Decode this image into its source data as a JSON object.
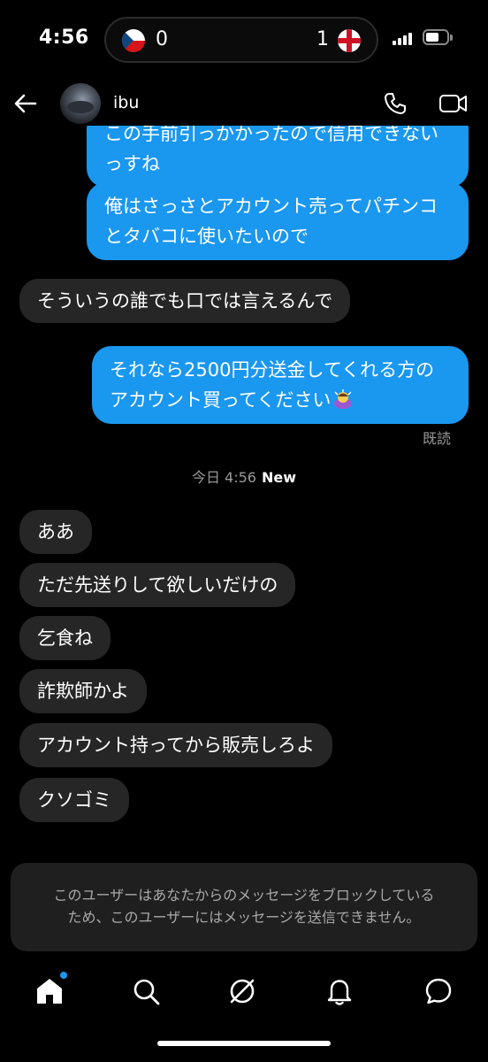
{
  "status_bar": {
    "time": "4:56",
    "score_left": "0",
    "score_right": "1"
  },
  "header": {
    "username": "ibu"
  },
  "messages": [
    {
      "dir": "out",
      "text": "この手前引っかかったので信用できない"
    },
    {
      "dir": "out",
      "text": "っすね"
    },
    {
      "dir": "out",
      "text": "俺はさっさとアカウント売ってパチンコ"
    },
    {
      "dir": "out",
      "text": "とタバコに使いたいので"
    },
    {
      "dir": "in",
      "text": "そういうの誰でも口では言えるんで"
    },
    {
      "dir": "out",
      "text": "それなら2500円分送金してくれる方の"
    },
    {
      "dir": "out",
      "text": "アカウント買ってください"
    },
    {
      "dir": "in",
      "text": "ああ"
    },
    {
      "dir": "in",
      "text": "ただ先送りして欲しいだけの"
    },
    {
      "dir": "in",
      "text": "乞食ね"
    },
    {
      "dir": "in",
      "text": "詐欺師かよ"
    },
    {
      "dir": "in",
      "text": "アカウント持ってから販売しろよ"
    },
    {
      "dir": "in",
      "text": "クソゴミ"
    }
  ],
  "read_receipt": "既読",
  "divider": {
    "time": "今日 4:56",
    "new_label": "New"
  },
  "block_notice": {
    "line1": "このユーザーはあなたからのメッセージをブロックしている",
    "line2": "ため、このユーザーにはメッセージを送信できません。"
  },
  "nav": [
    "home-icon",
    "search-icon",
    "explore-icon",
    "notifications-icon",
    "messages-icon"
  ],
  "colors": {
    "outgoing_bubble": "#1a97ef",
    "incoming_bubble": "#262626",
    "background": "#000000"
  }
}
